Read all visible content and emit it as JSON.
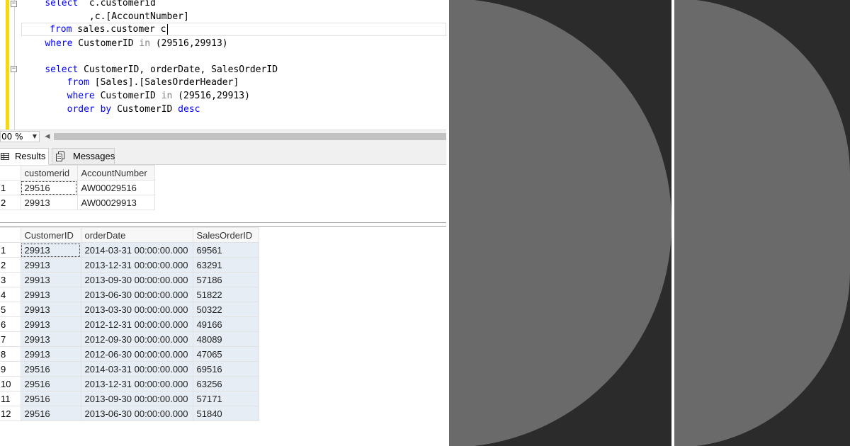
{
  "editor": {
    "lines": [
      [
        "select  c.customerid"
      ],
      [
        "         ,c.[AccountNumber]"
      ],
      [
        "from sales.customer c"
      ],
      [
        "where CustomerID in (29516,29913)"
      ],
      [
        ""
      ],
      [
        "select CustomerID, orderDate, SalesOrderID"
      ],
      [
        "    from [Sales].[SalesOrderHeader]"
      ],
      [
        "    where CustomerID in (29516,29913)"
      ],
      [
        "    order by CustomerID desc"
      ]
    ],
    "accent_color": "#f5d90b"
  },
  "zoom": {
    "value": "00 %"
  },
  "tabs": {
    "results": "Results",
    "messages": "Messages"
  },
  "grid1": {
    "columns": [
      "customerid",
      "AccountNumber"
    ],
    "rows": [
      [
        "1",
        "29516",
        "AW00029516"
      ],
      [
        "2",
        "29913",
        "AW00029913"
      ]
    ]
  },
  "grid2": {
    "columns": [
      "CustomerID",
      "orderDate",
      "SalesOrderID"
    ],
    "rows": [
      [
        "1",
        "29913",
        "2014-03-31 00:00:00.000",
        "69561"
      ],
      [
        "2",
        "29913",
        "2013-12-31 00:00:00.000",
        "63291"
      ],
      [
        "3",
        "29913",
        "2013-09-30 00:00:00.000",
        "57186"
      ],
      [
        "4",
        "29913",
        "2013-06-30 00:00:00.000",
        "51822"
      ],
      [
        "5",
        "29913",
        "2013-03-30 00:00:00.000",
        "50322"
      ],
      [
        "6",
        "29913",
        "2012-12-31 00:00:00.000",
        "49166"
      ],
      [
        "7",
        "29913",
        "2012-09-30 00:00:00.000",
        "48089"
      ],
      [
        "8",
        "29913",
        "2012-06-30 00:00:00.000",
        "47065"
      ],
      [
        "9",
        "29516",
        "2014-03-31 00:00:00.000",
        "69516"
      ],
      [
        "10",
        "29516",
        "2013-12-31 00:00:00.000",
        "63256"
      ],
      [
        "11",
        "29516",
        "2013-09-30 00:00:00.000",
        "57171"
      ],
      [
        "12",
        "29516",
        "2013-06-30 00:00:00.000",
        "51840"
      ]
    ]
  }
}
